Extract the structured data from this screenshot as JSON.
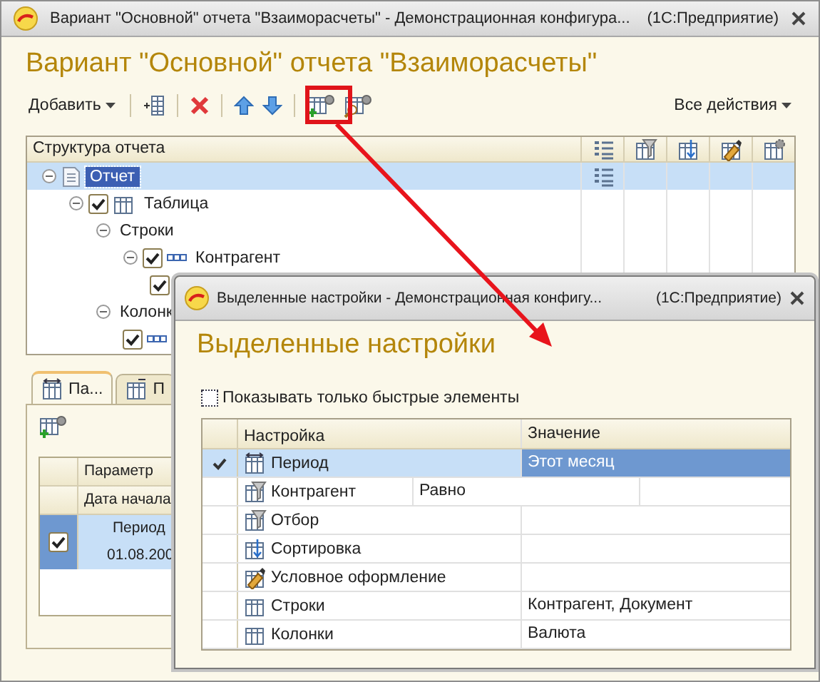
{
  "window": {
    "title": "Вариант \"Основной\" отчета \"Взаиморасчеты\" - Демонстрационная конфигура...",
    "app": "(1С:Предприятие)",
    "heading": "Вариант \"Основной\" отчета \"Взаиморасчеты\""
  },
  "toolbar": {
    "add_menu": "Добавить",
    "all_actions": "Все действия"
  },
  "structure": {
    "header": "Структура отчета",
    "tree": [
      {
        "kind": "report",
        "label": "Отчет",
        "selected": true,
        "expanded": true,
        "children": [
          {
            "kind": "table",
            "label": "Таблица",
            "checked": true,
            "selected": false,
            "expanded": true,
            "children": [
              {
                "kind": "group",
                "label": "Строки",
                "selected": false,
                "expanded": true,
                "children": [
                  {
                    "kind": "field",
                    "label": "Контрагент",
                    "checked": true,
                    "selected": false,
                    "expanded": true,
                    "children": [
                      {
                        "kind": "item",
                        "checked": true,
                        "selected": false
                      }
                    ]
                  }
                ]
              },
              {
                "kind": "group",
                "label": "Колонк",
                "selected": false,
                "expanded": true,
                "children": [
                  {
                    "kind": "field",
                    "checked": true,
                    "selected": false
                  }
                ]
              }
            ]
          }
        ]
      }
    ]
  },
  "bottom_tabs": [
    {
      "label": "Па...",
      "selected": true
    },
    {
      "label": "П",
      "selected": false
    }
  ],
  "parameters": {
    "header": "Параметр",
    "subheader": "Дата начала",
    "rows": [
      {
        "checked": true,
        "selected": true,
        "name": "Период",
        "value": "01.08.200"
      }
    ]
  },
  "dialog": {
    "title": "Выделенные настройки - Демонстрационная конфигу...",
    "app": "(1С:Предприятие)",
    "heading": "Выделенные настройки",
    "quick_only": {
      "label": "Показывать только быстрые элементы",
      "checked": false
    },
    "columns": [
      "Настройка",
      "Значение"
    ],
    "rows": [
      {
        "kind": "period",
        "name": "Период",
        "value": "Этот месяц",
        "used": true,
        "selected": true
      },
      {
        "kind": "filter_item",
        "name": "Контрагент",
        "condition": "Равно",
        "used": false,
        "selected": false
      },
      {
        "kind": "filter",
        "name": "Отбор",
        "used": false,
        "selected": false
      },
      {
        "kind": "sort",
        "name": "Сортировка",
        "used": false,
        "selected": false
      },
      {
        "kind": "appearance",
        "name": "Условное оформление",
        "used": false,
        "selected": false
      },
      {
        "kind": "grouping",
        "name": "Строки",
        "value": "Контрагент, Документ",
        "used": false,
        "selected": false
      },
      {
        "kind": "grouping",
        "name": "Колонки",
        "value": "Валюта",
        "used": false,
        "selected": false
      }
    ]
  }
}
